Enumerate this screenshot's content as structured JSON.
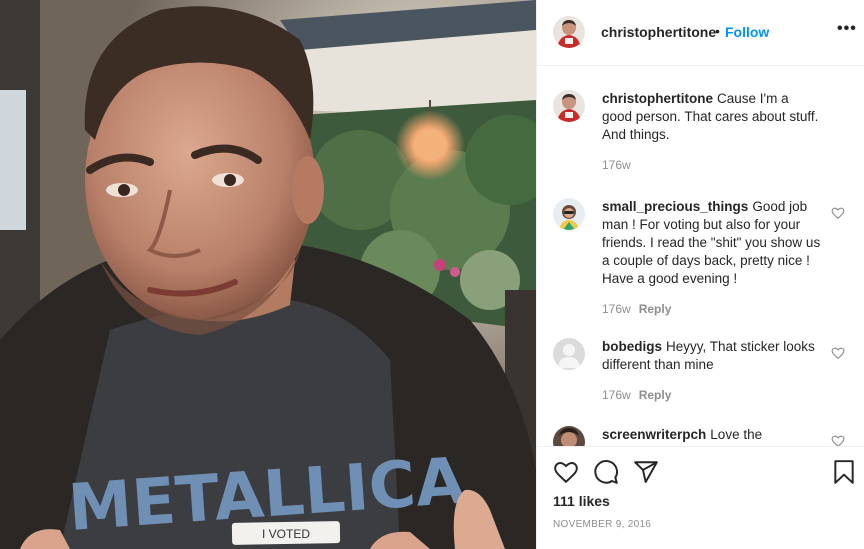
{
  "post": {
    "photo_sticker": "I VOTED",
    "photo_shirt_text": "METALLICA"
  },
  "header": {
    "username": "christophertitone",
    "separator": "•",
    "follow_label": "Follow",
    "more_label": "•••",
    "more_icon": "more-horizontal-icon"
  },
  "comments": [
    {
      "username": "christophertitone",
      "text": "Cause I'm a good person. That cares about stuff. And things.",
      "time": "176w",
      "reply": ""
    },
    {
      "username": "small_precious_things",
      "text": "Good job man ! For voting but also for your friends. I read the \"shit\" you show us a couple of days back, pretty nice ! Have a good evening !",
      "time": "176w",
      "reply": "Reply"
    },
    {
      "username": "bobedigs",
      "text": "Heyyy, That sticker looks different than mine",
      "time": "176w",
      "reply": "Reply"
    },
    {
      "username": "screenwriterpch",
      "text": "Love the",
      "time": "",
      "reply": ""
    }
  ],
  "actions": {
    "like_icon": "heart-icon",
    "comment_icon": "comment-icon",
    "share_icon": "send-icon",
    "save_icon": "bookmark-icon",
    "likes": "111 likes",
    "date": "NOVEMBER 9, 2016"
  },
  "colors": {
    "link": "#0095f6",
    "text": "#262626",
    "muted": "#8e8e8e",
    "border": "#efefef"
  }
}
